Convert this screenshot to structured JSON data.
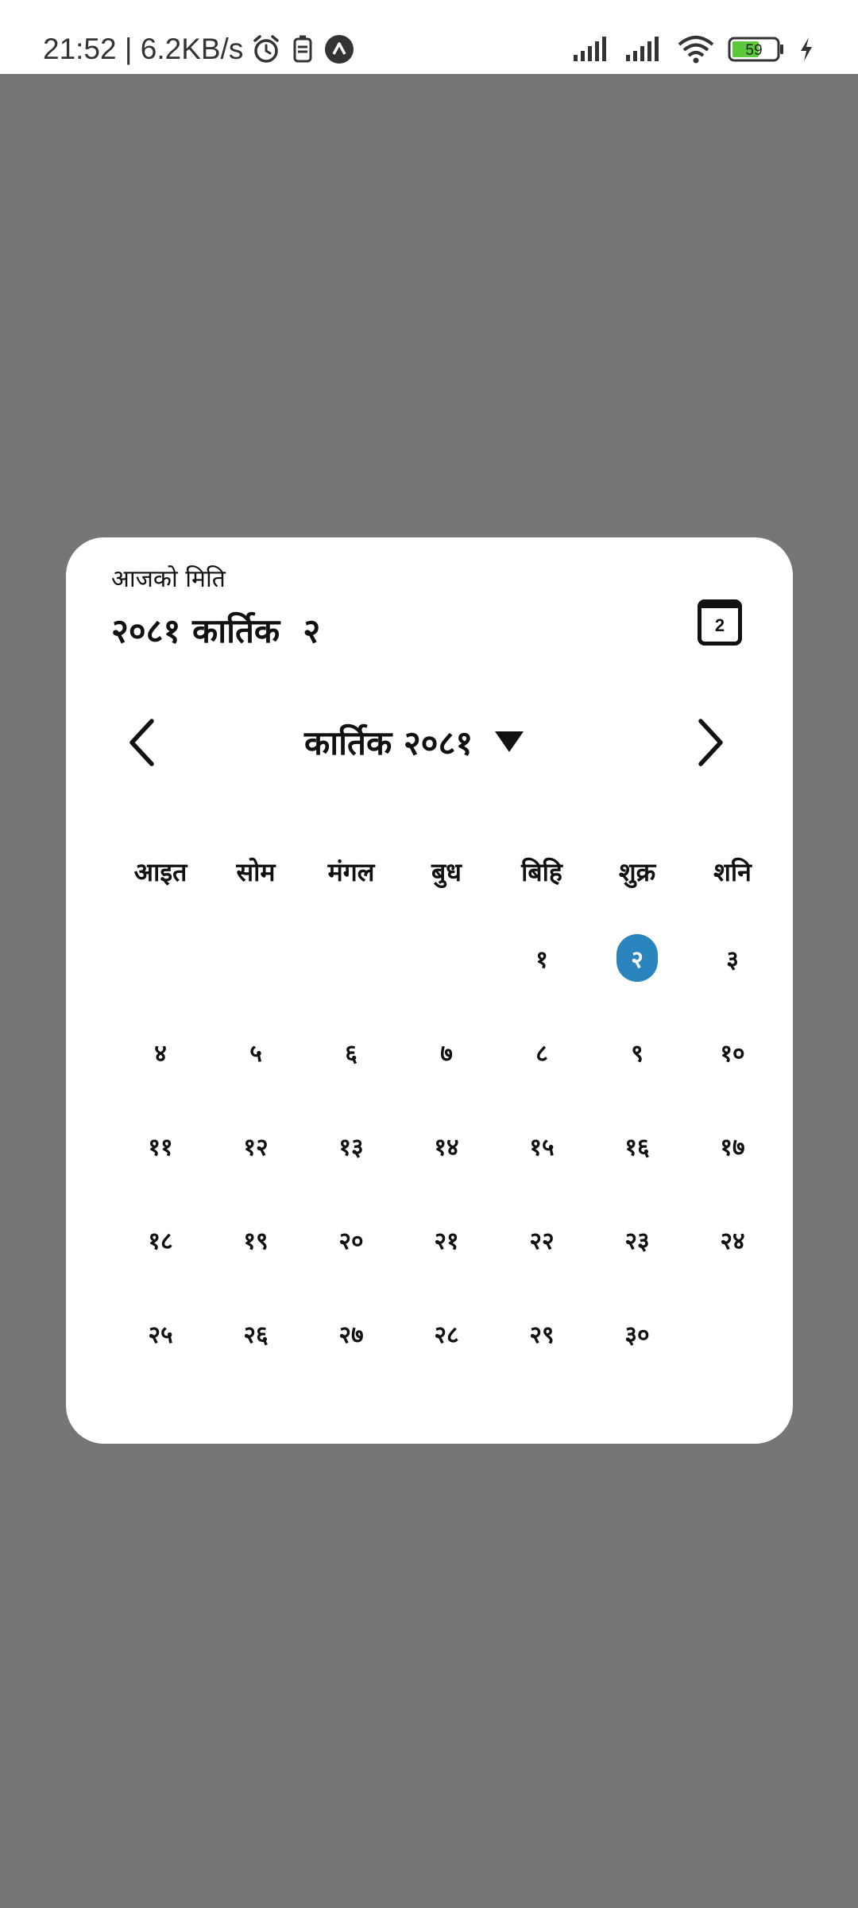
{
  "status_bar": {
    "time_speed": "21:52 | 6.2KB/s",
    "battery": "59"
  },
  "dialog": {
    "today_label": "आजको मिति",
    "today_date": "२०८१ कार्तिक  २",
    "today_button_label": "2",
    "month_title": "कार्तिक २०८१",
    "weekdays": [
      "आइत",
      "सोम",
      "मंगल",
      "बुध",
      "बिहि",
      "शुक्र",
      "शनि"
    ],
    "weeks": [
      [
        "",
        "",
        "",
        "",
        "१",
        "२",
        "३"
      ],
      [
        "४",
        "५",
        "६",
        "७",
        "८",
        "९",
        "१०"
      ],
      [
        "११",
        "१२",
        "१३",
        "१४",
        "१५",
        "१६",
        "१७"
      ],
      [
        "१८",
        "१९",
        "२०",
        "२१",
        "२२",
        "२३",
        "२४"
      ],
      [
        "२५",
        "२६",
        "२७",
        "२८",
        "२९",
        "३०",
        ""
      ]
    ],
    "selected_day": "२",
    "accent_color": "#2a85bf"
  },
  "icons": {
    "status": [
      "alarm-icon",
      "sim-icon",
      "app-notification-icon",
      "signal-icon",
      "signal-icon",
      "wifi-icon",
      "battery-icon",
      "charging-icon"
    ],
    "nav": [
      "chevron-left-icon",
      "dropdown-triangle-icon",
      "chevron-right-icon",
      "calendar-today-icon"
    ]
  }
}
